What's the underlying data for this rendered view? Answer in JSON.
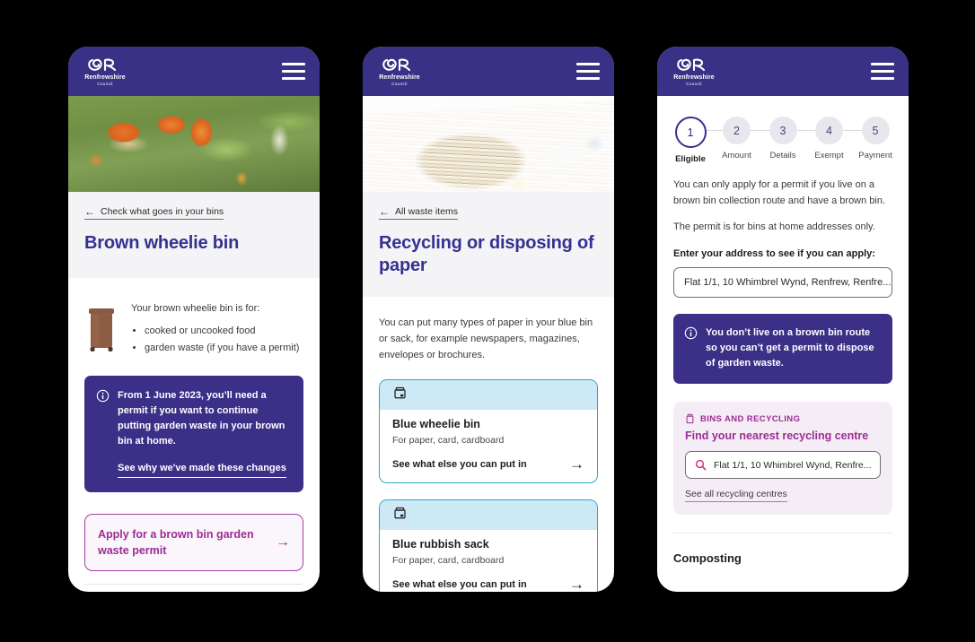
{
  "brand": {
    "name": "Renfrewshire",
    "sub": "Council",
    "header_color": "#383185",
    "accent_purple": "#3b2f87",
    "accent_magenta": "#9c2d93",
    "accent_blue": "#2aa5cf",
    "title_color": "#363191"
  },
  "icons": {
    "menu": "hamburger-menu-icon",
    "back": "←",
    "arrow_right": "→",
    "info": "info-circle-icon",
    "bin": "bin-icon",
    "search": "search-icon"
  },
  "phone1": {
    "back_link": "Check what goes in your bins",
    "title": "Brown wheelie bin",
    "bin_intro": "Your brown wheelie bin is for:",
    "bin_items": [
      "cooked or uncooked food",
      "garden waste (if you have a permit)"
    ],
    "info_text": "From 1 June 2023, you’ll need a permit if you want to continue putting garden waste in your brown bin at home.",
    "info_link": "See why we've made these changes",
    "cta_label": "Apply for a brown bin garden waste permit"
  },
  "phone2": {
    "back_link": "All waste items",
    "title": "Recycling or disposing of paper",
    "body": "You can put many types of paper in your blue bin or sack, for example newspapers, magazines, envelopes or brochures.",
    "cards": [
      {
        "title": "Blue wheelie bin",
        "subtitle": "For paper, card, cardboard",
        "action": "See what else you can put in"
      },
      {
        "title": "Blue rubbish sack",
        "subtitle": "For paper, card, cardboard",
        "action": "See what else you can put in"
      }
    ]
  },
  "phone3": {
    "steps": [
      {
        "num": "1",
        "label": "Eligible",
        "active": true
      },
      {
        "num": "2",
        "label": "Amount",
        "active": false
      },
      {
        "num": "3",
        "label": "Details",
        "active": false
      },
      {
        "num": "4",
        "label": "Exempt",
        "active": false
      },
      {
        "num": "5",
        "label": "Payment",
        "active": false
      }
    ],
    "para1": "You can only apply for a permit if you live on a brown bin collection route and have a brown bin.",
    "para2": "The permit is for bins at home addresses only.",
    "field_label": "Enter your address to see if you can apply:",
    "address_value": "Flat 1/1, 10 Whimbrel Wynd, Renfrew, Renfre...",
    "alert_text": "You don’t live on a brown bin route so you can’t get a permit to dispose of garden waste.",
    "promo_kicker": "BINS AND RECYCLING",
    "promo_title": "Find your nearest recycling centre",
    "promo_search_value": "Flat 1/1, 10 Whimbrel Wynd, Renfre...",
    "promo_link": "See all recycling centres",
    "section_title": "Composting"
  }
}
